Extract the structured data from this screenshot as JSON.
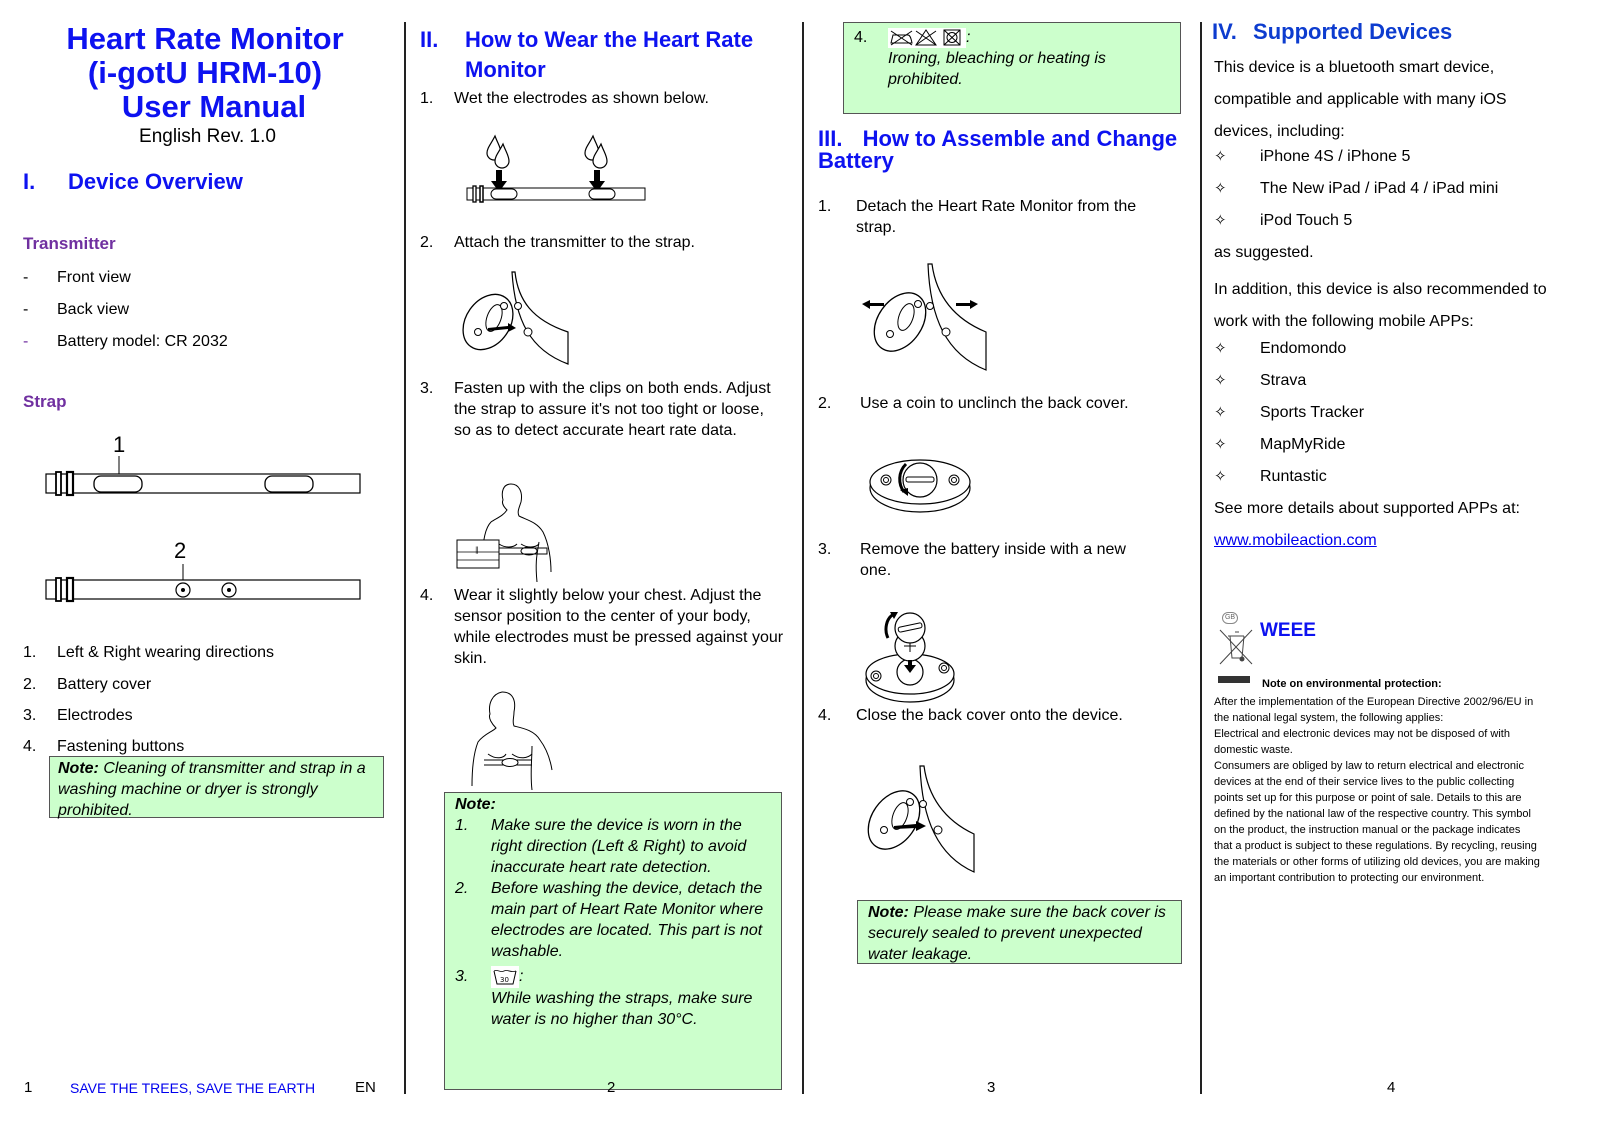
{
  "document": {
    "title_lines": [
      "Heart Rate Monitor",
      "(i-gotU HRM-10)",
      "User Manual"
    ],
    "subtitle": "English Rev. 1.0"
  },
  "section1": {
    "numeral": "I.",
    "heading": "Device Overview",
    "transmitter": {
      "heading": "Transmitter",
      "items": [
        {
          "bullet": "-",
          "text": "Front view"
        },
        {
          "bullet": "-",
          "text": "Back view"
        },
        {
          "bullet": "-",
          "text": "Battery model: CR 2032"
        }
      ]
    },
    "strap": {
      "heading": "Strap",
      "callout_1": "1",
      "callout_2": "2"
    },
    "legend": [
      {
        "num": "1.",
        "text": "Left & Right wearing directions"
      },
      {
        "num": "2.",
        "text": "Battery cover"
      },
      {
        "num": "3.",
        "text": "Electrodes"
      },
      {
        "num": "4.",
        "text": "Fastening buttons"
      }
    ],
    "note": {
      "label": "Note:",
      "text": " Cleaning of transmitter and strap in a washing machine or dryer is strongly prohibited."
    }
  },
  "section2": {
    "numeral": "II.",
    "heading_line1": "How to Wear the Heart Rate",
    "heading_line2": "Monitor",
    "steps": [
      {
        "num": "1.",
        "text": "Wet the electrodes as shown below."
      },
      {
        "num": "2.",
        "text": "Attach the transmitter to the strap."
      },
      {
        "num": "3.",
        "text": "Fasten up with the clips on both ends. Adjust the strap to assure it's not too tight or loose, so as to detect accurate heart rate data."
      },
      {
        "num": "4.",
        "text": "Wear it slightly below your chest. Adjust the sensor position to the center of your body, while electrodes must be pressed against your skin."
      }
    ],
    "note": {
      "label": "Note:",
      "items": [
        {
          "num": "1.",
          "text": "Make sure the device is worn in the right direction (Left & Right) to avoid inaccurate heart rate detection."
        },
        {
          "num": "2.",
          "text": "Before washing the device, detach the main part of Heart Rate Monitor where electrodes are located. This part is not washable."
        },
        {
          "num": "3.",
          "icon_label": "30",
          "suffix": ":",
          "text": "While washing the straps, make sure water is no higher than 30°C."
        }
      ]
    }
  },
  "section3": {
    "note_continued": {
      "num": "4.",
      "suffix": ":",
      "text": "Ironing, bleaching or heating is prohibited."
    },
    "numeral": "III.",
    "heading_line1": "How to Assemble and Change",
    "heading_line2": "Battery",
    "steps": [
      {
        "num": "1.",
        "text": "Detach the Heart Rate Monitor from the strap."
      },
      {
        "num": "2.",
        "text": "Use a coin to unclinch the back cover."
      },
      {
        "num": "3.",
        "text": "Remove the battery inside with a new one."
      },
      {
        "num": "4.",
        "text": "Close the back cover onto the device."
      }
    ],
    "note": {
      "label": "Note:",
      "text": " Please make sure the back cover is securely sealed to prevent unexpected water leakage."
    }
  },
  "section4": {
    "numeral": "IV.",
    "heading": "Supported Devices",
    "intro_lines": [
      "This device is a bluetooth smart device,",
      "compatible and applicable with many iOS",
      "devices, including:"
    ],
    "devices": [
      "iPhone 4S / iPhone 5",
      "The New iPad / iPad 4 / iPad mini",
      "iPod Touch 5"
    ],
    "after_devices": "as suggested.",
    "apps_intro_lines": [
      "In addition, this device is also recommended to",
      "work with the following mobile APPs:"
    ],
    "apps": [
      "Endomondo",
      "Strava",
      "Sports Tracker",
      "MapMyRide",
      "Runtastic"
    ],
    "more_details": "See more details about supported APPs at:",
    "link": "www.mobileaction.com",
    "weee": {
      "badge": "GB",
      "heading": "WEEE",
      "note_heading": "Note on environmental protection:",
      "paragraph_lines": [
        "After the implementation of the European Directive 2002/96/EU in",
        "the national legal system, the following applies:",
        "Electrical and electronic devices may not be disposed of with",
        "domestic waste.",
        "Consumers are obliged by law to return electrical and electronic",
        "devices at the end of their service lives to the public collecting",
        "points set up for this purpose or point of sale. Details to this are",
        "defined by the national law of the respective country. This symbol",
        "on the product, the instruction manual or the package indicates",
        "that a product is subject to these regulations. By recycling, reusing",
        "the materials or other forms of utilizing old devices, you are making",
        "an important contribution to protecting our environment."
      ]
    }
  },
  "footer": {
    "page1": "1",
    "slogan": "SAVE THE TREES, SAVE THE EARTH",
    "lang": "EN",
    "page2": "2",
    "page3": "3",
    "page4": "4"
  },
  "colors": {
    "heading_blue": "#0d12f0",
    "subheading_purple": "#7030a0",
    "note_green": "#ccffcc",
    "link_blue": "#0000ee"
  }
}
